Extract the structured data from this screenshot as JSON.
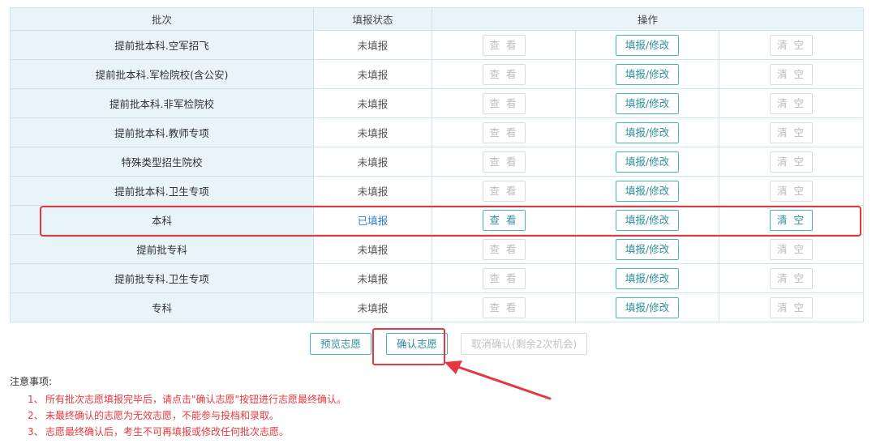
{
  "table": {
    "headers": {
      "batch": "批次",
      "status": "填报状态",
      "actions": "操作"
    },
    "rows": [
      {
        "batch": "提前批本科.空军招飞",
        "status": "未填报",
        "filled": false,
        "view": "查 看",
        "edit": "填报/修改",
        "clear": "清 空"
      },
      {
        "batch": "提前批本科.军检院校(含公安)",
        "status": "未填报",
        "filled": false,
        "view": "查 看",
        "edit": "填报/修改",
        "clear": "清 空"
      },
      {
        "batch": "提前批本科.非军检院校",
        "status": "未填报",
        "filled": false,
        "view": "查 看",
        "edit": "填报/修改",
        "clear": "清 空"
      },
      {
        "batch": "提前批本科.教师专项",
        "status": "未填报",
        "filled": false,
        "view": "查 看",
        "edit": "填报/修改",
        "clear": "清 空"
      },
      {
        "batch": "特殊类型招生院校",
        "status": "未填报",
        "filled": false,
        "view": "查 看",
        "edit": "填报/修改",
        "clear": "清 空"
      },
      {
        "batch": "提前批本科.卫生专项",
        "status": "未填报",
        "filled": false,
        "view": "查 看",
        "edit": "填报/修改",
        "clear": "清 空"
      },
      {
        "batch": "本科",
        "status": "已填报",
        "filled": true,
        "view": "查 看",
        "edit": "填报/修改",
        "clear": "清 空"
      },
      {
        "batch": "提前批专科",
        "status": "未填报",
        "filled": false,
        "view": "查 看",
        "edit": "填报/修改",
        "clear": "清 空"
      },
      {
        "batch": "提前批专科.卫生专项",
        "status": "未填报",
        "filled": false,
        "view": "查 看",
        "edit": "填报/修改",
        "clear": "清 空"
      },
      {
        "batch": "专科",
        "status": "未填报",
        "filled": false,
        "view": "查 看",
        "edit": "填报/修改",
        "clear": "清 空"
      }
    ]
  },
  "actions": {
    "preview": "预览志愿",
    "confirm": "确认志愿",
    "cancel": "取消确认(剩余2次机会)"
  },
  "notes": {
    "title": "注意事项:",
    "items": [
      {
        "num": "1、",
        "text": "所有批次志愿填报完毕后，请点击\"确认志愿\"按钮进行志愿最终确认。"
      },
      {
        "num": "2、",
        "text": "未最终确认的志愿为无效志愿，不能参与投档和录取。"
      },
      {
        "num": "3、",
        "text": "志愿最终确认后，考生不可再填报或修改任何批次志愿。"
      }
    ]
  },
  "colors": {
    "highlight": "#e5383e",
    "accent": "#43b6bd",
    "header_bg": "#e9f4f9",
    "filled_status": "#2e7fd6"
  }
}
